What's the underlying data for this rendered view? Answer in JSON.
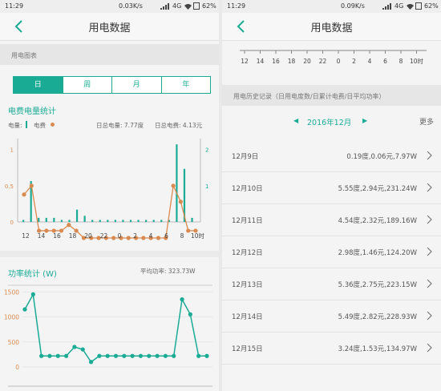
{
  "status_left": {
    "time": "11:29",
    "speed": "0.03K/s",
    "network": "4G",
    "battery": "62%"
  },
  "status_right": {
    "time": "11:29",
    "speed": "0.09K/s",
    "network": "4G",
    "battery": "62%"
  },
  "left": {
    "title": "用电数据",
    "section": "用电图表",
    "tabs": [
      "日",
      "周",
      "月",
      "年"
    ],
    "active_tab": 0,
    "stats_title": "电费电量统计",
    "legend_power": "电量:",
    "legend_fee": "电费",
    "daily_power": "日总电量: 7.77度",
    "daily_fee": "日总电费: 4.13元",
    "power_title": "功率统计 (W)",
    "avg_power": "平均功率: 323.73W"
  },
  "right": {
    "title": "用电数据",
    "history_section": "用电历史记录（日用电度数/日累计电费/日平均功率）",
    "month": "2016年12月",
    "more": "更多",
    "records": [
      {
        "date": "12月9日",
        "value": "0.19度,0.06元,7.97W"
      },
      {
        "date": "12月10日",
        "value": "5.55度,2.94元,231.24W"
      },
      {
        "date": "12月11日",
        "value": "4.54度,2.32元,189.16W"
      },
      {
        "date": "12月12日",
        "value": "2.98度,1.46元,124.20W"
      },
      {
        "date": "12月13日",
        "value": "5.36度,2.75元,223.15W"
      },
      {
        "date": "12月14日",
        "value": "5.49度,2.82元,228.93W"
      },
      {
        "date": "12月15日",
        "value": "3.24度,1.53元,134.97W"
      }
    ]
  },
  "colors": {
    "accent": "#1aab95",
    "fee": "#d98a50"
  },
  "chart_data": [
    {
      "type": "bar",
      "title": "电费电量统计",
      "x_ticks": [
        "12",
        "14",
        "16",
        "18",
        "20",
        "22",
        "0",
        "2",
        "4",
        "6",
        "8",
        "10时"
      ],
      "y_left_ticks": [
        "0",
        "0.5",
        "1"
      ],
      "y_right_ticks": [
        "1",
        "2",
        "3"
      ],
      "series": [
        {
          "name": "电量",
          "axis": "right",
          "values": [
            0.05,
            1.0,
            0.1,
            0.1,
            0.1,
            0.05,
            0.05,
            0.3,
            0.15,
            0.05,
            0.05,
            0.05,
            0.05,
            0.05,
            0.05,
            0.05,
            0.05,
            0.05,
            0.05,
            0.05,
            1.9,
            1.3,
            0.1
          ]
        },
        {
          "name": "电费",
          "axis": "left",
          "values": [
            0.6,
            0.72,
            0.1,
            0.1,
            0.1,
            0.1,
            0.18,
            0.1,
            0.0,
            0.0,
            0.0,
            0.0,
            0.0,
            0.0,
            0.0,
            0.0,
            0.0,
            0.0,
            0.0,
            0.0,
            0.72,
            0.5,
            0.1,
            0.1
          ]
        }
      ],
      "ylim": [
        0,
        1.15
      ]
    },
    {
      "type": "line",
      "title": "功率统计 (W)",
      "y_ticks": [
        "0",
        "500",
        "1000",
        "1500"
      ],
      "ylim": [
        0,
        1600
      ],
      "series": [
        {
          "name": "功率",
          "values": [
            1150,
            1450,
            220,
            220,
            220,
            220,
            400,
            350,
            100,
            220,
            220,
            220,
            220,
            220,
            220,
            220,
            220,
            220,
            220,
            1350,
            1050,
            220,
            220
          ]
        }
      ]
    },
    {
      "type": "scale",
      "x_ticks": [
        "12",
        "14",
        "16",
        "18",
        "20",
        "22",
        "0",
        "2",
        "4",
        "6",
        "8",
        "10时"
      ]
    }
  ]
}
